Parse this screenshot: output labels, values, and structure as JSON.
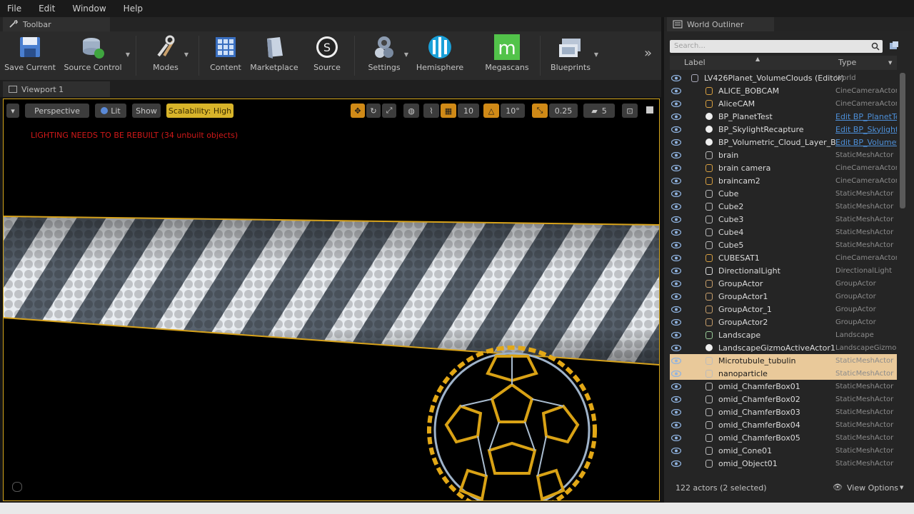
{
  "menu": [
    "File",
    "Edit",
    "Window",
    "Help"
  ],
  "tabs": {
    "toolbar": "Toolbar",
    "viewport": "Viewport 1",
    "outliner": "World Outliner"
  },
  "toolbar": {
    "save_current": "Save Current",
    "source_control": "Source Control",
    "modes": "Modes",
    "content": "Content",
    "marketplace": "Marketplace",
    "source": "Source",
    "settings": "Settings",
    "hemisphere": "Hemisphere",
    "megascans": "Megascans",
    "blueprints": "Blueprints",
    "more": "»"
  },
  "viewport": {
    "perspective": "Perspective",
    "lit": "Lit",
    "show": "Show",
    "scalability": "Scalability: High",
    "grid_snap": "10",
    "rot_snap": "10°",
    "scale_snap": "0.25",
    "cam_speed": "5",
    "warning": "LIGHTING NEEDS TO BE REBUILT (34 unbuilt objects)"
  },
  "outliner": {
    "search_placeholder": "Search...",
    "col_label": "Label",
    "col_type": "Type",
    "rows": [
      {
        "label": "LV426Planet_VolumeClouds (Editor)",
        "type": "World"
      },
      {
        "label": "ALICE_BOBCAM",
        "type": "CineCameraActor"
      },
      {
        "label": "AliceCAM",
        "type": "CineCameraActor"
      },
      {
        "label": "BP_PlanetTest",
        "type": "Edit BP_PlanetTest"
      },
      {
        "label": "BP_SkylightRecapture",
        "type": "Edit BP_SkylightRecapture"
      },
      {
        "label": "BP_Volumetric_Cloud_Layer_B",
        "type": "Edit BP_Volumetric"
      },
      {
        "label": "brain",
        "type": "StaticMeshActor"
      },
      {
        "label": "brain camera",
        "type": "CineCameraActor"
      },
      {
        "label": "braincam2",
        "type": "CineCameraActor"
      },
      {
        "label": "Cube",
        "type": "StaticMeshActor"
      },
      {
        "label": "Cube2",
        "type": "StaticMeshActor"
      },
      {
        "label": "Cube3",
        "type": "StaticMeshActor"
      },
      {
        "label": "Cube4",
        "type": "StaticMeshActor"
      },
      {
        "label": "Cube5",
        "type": "StaticMeshActor"
      },
      {
        "label": "CUBESAT1",
        "type": "CineCameraActor"
      },
      {
        "label": "DirectionalLight",
        "type": "DirectionalLight"
      },
      {
        "label": "GroupActor",
        "type": "GroupActor"
      },
      {
        "label": "GroupActor1",
        "type": "GroupActor"
      },
      {
        "label": "GroupActor_1",
        "type": "GroupActor"
      },
      {
        "label": "GroupActor2",
        "type": "GroupActor"
      },
      {
        "label": "Landscape",
        "type": "Landscape"
      },
      {
        "label": "LandscapeGizmoActiveActor1",
        "type": "LandscapeGizmo"
      },
      {
        "label": "Microtubule_tubulin",
        "type": "StaticMeshActor"
      },
      {
        "label": "nanoparticle",
        "type": "StaticMeshActor"
      },
      {
        "label": "omid_ChamferBox01",
        "type": "StaticMeshActor"
      },
      {
        "label": "omid_ChamferBox02",
        "type": "StaticMeshActor"
      },
      {
        "label": "omid_ChamferBox03",
        "type": "StaticMeshActor"
      },
      {
        "label": "omid_ChamferBox04",
        "type": "StaticMeshActor"
      },
      {
        "label": "omid_ChamferBox05",
        "type": "StaticMeshActor"
      },
      {
        "label": "omid_Cone01",
        "type": "StaticMeshActor"
      },
      {
        "label": "omid_Object01",
        "type": "StaticMeshActor"
      }
    ],
    "status": "122 actors (2 selected)",
    "view_options": "View Options"
  }
}
